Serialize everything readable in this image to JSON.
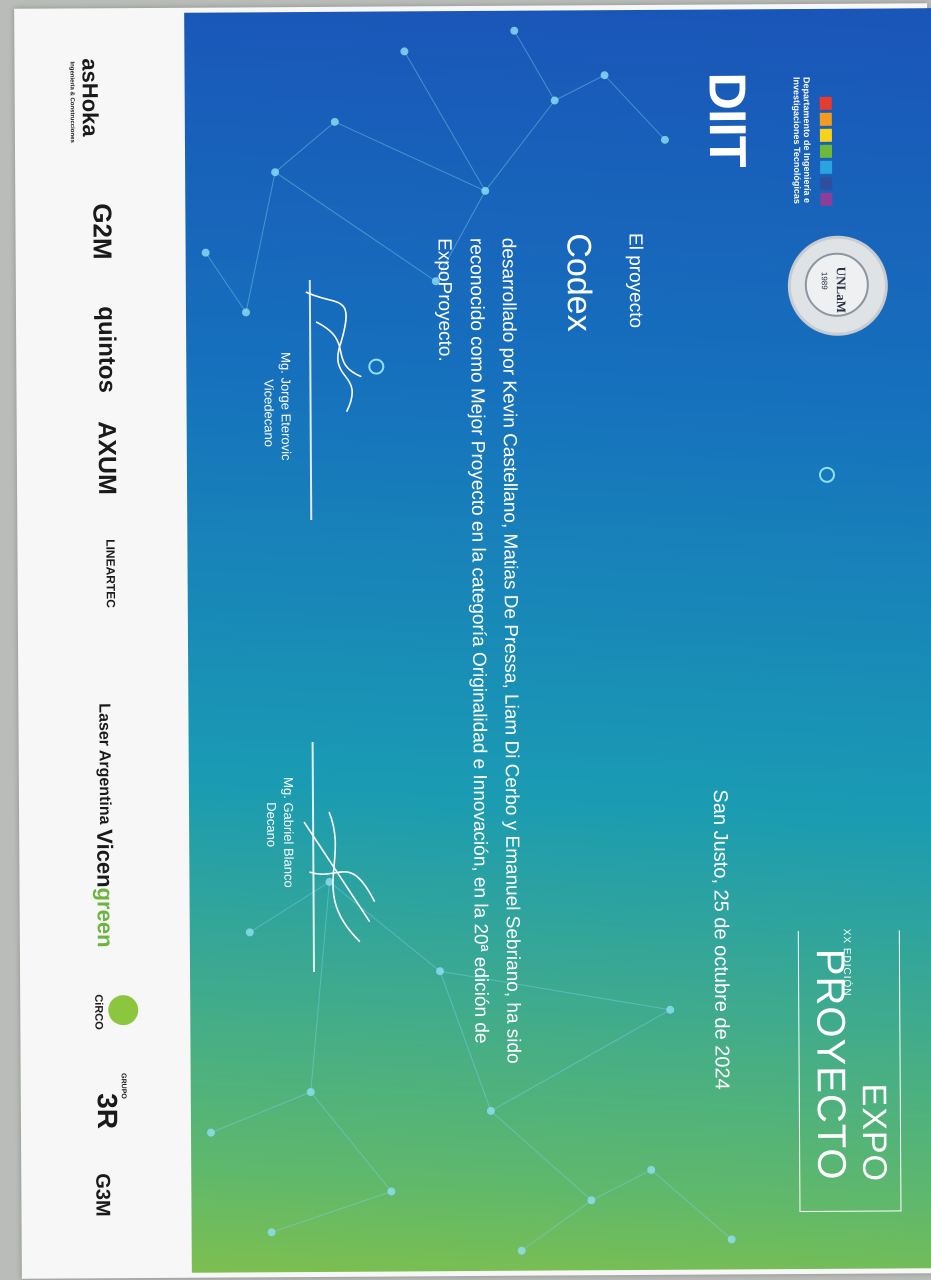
{
  "diit": {
    "title": "DIIT",
    "subtitle": "Departamento de Ingeniería e Investigaciones Tecnológicas",
    "bar_colors": [
      "#e63c2f",
      "#f29b1d",
      "#f6d21b",
      "#6fb93a",
      "#2aa4dc",
      "#2d4f9e",
      "#8b3f98"
    ]
  },
  "seal": {
    "label": "UNLaM",
    "year": "1989"
  },
  "event": {
    "edition": "XX EDICIÓN",
    "word_expo": "EXPO",
    "word_proyecto": "PROYECTO"
  },
  "certificate": {
    "date": "San Justo, 25 de octubre de 2024",
    "intro": "El proyecto",
    "project_name": "Codex",
    "body": "desarrollado por Kevin Castellano, Matias De Pressa, Liam Di Cerbo y Emanuel Sebriano, ha sido reconocido como Mejor Proyecto en la categoría Originalidad e Innovación, en la 20ª edición de ExpoProyecto."
  },
  "signatures": [
    {
      "name": "Mg. Jorge Eterovic",
      "role": "Vicedecano"
    },
    {
      "name": "Mg. Gabriel Blanco",
      "role": "Decano"
    }
  ],
  "sponsors": {
    "ashoka": "asHoka",
    "ashoka_sub": "Ingeniería & Construcciones",
    "g2m": "G2M",
    "quintos": "quintos",
    "axum": "AXUM",
    "lineartec": "LINEARTEC",
    "laser": "Laser Argentina",
    "vicengreen_a": "Vicen",
    "vicengreen_b": "green",
    "circo": "CiRCO",
    "grupo": "GRUPO",
    "r3": "3R",
    "g3m": "G3M"
  },
  "colors": {
    "card_top": "#1a55b8",
    "card_bottom": "#7dbf4f",
    "text": "#ffffff",
    "vicengreen": "#6cb33f"
  }
}
